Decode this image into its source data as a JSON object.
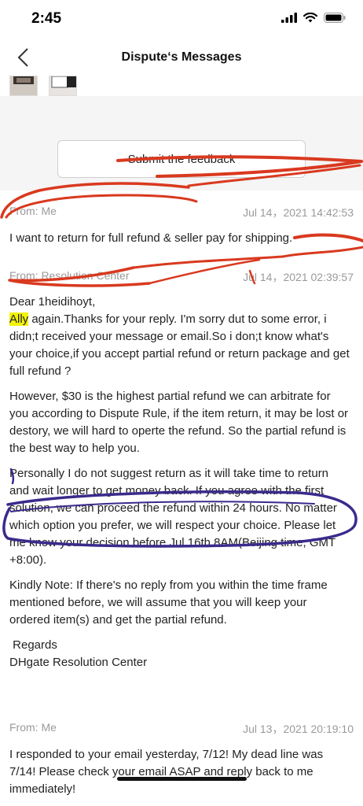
{
  "status": {
    "time": "2:45"
  },
  "nav": {
    "title": "Dispute‘s Messages",
    "back_icon": "chevron-left-icon"
  },
  "actions": {
    "submit_label": "Submit the feedback"
  },
  "messages": [
    {
      "from": "From: Me",
      "date": "Jul 14，2021 14:42:53",
      "body": [
        "I want to return for full refund & seller pay for shipping."
      ]
    },
    {
      "from": "From: Resolution Center",
      "date": "Jul 14，2021 02:39:57",
      "greeting": "Dear 1heidihoyt,",
      "highlight": "Ally",
      "first_para_rest": " again.Thanks for your reply. I'm sorry dut to some error, i didn;t received your message or email.So i don;t know what's your choice,if you accept partial refund or return package and get full refund ?",
      "body": [
        "However, $30 is the highest partial refund we can arbitrate for you according to Dispute Rule, if the item return, it may be lost or destory, we will hard to operte the refund. So the partial refund is the best way to help you.",
        "Personally I do not suggest return as it will take time to return and wait longer to get money back. If you agree with the first solution, we can proceed the refund within 24 hours. No matter which option you prefer, we will respect your choice. Please let me know your decision before Jul.16th.8AM(Beijing time, GMT +8:00).",
        "Kindly Note: If there's no reply from you within the time frame mentioned before, we will assume that you will keep your ordered item(s) and get the partial refund."
      ],
      "regards": " Regards",
      "signature": "DHgate Resolution Center"
    },
    {
      "from": "From: Me",
      "date": "Jul 13，2021 20:19:10",
      "body": [
        "I responded to your email yesterday, 7/12! My dead line was 7/14! Please check your email ASAP and reply back to me immediately!"
      ]
    }
  ],
  "colors": {
    "red_ink": "#d9391f",
    "purple_ink": "#3b2a8c",
    "highlight": "#f2f20b"
  }
}
